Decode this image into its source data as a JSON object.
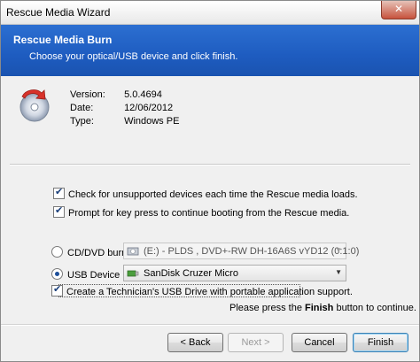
{
  "window": {
    "title": "Rescue Media Wizard",
    "close_glyph": "✕"
  },
  "banner": {
    "title": "Rescue Media Burn",
    "subtitle": "Choose your optical/USB device and click finish."
  },
  "info": {
    "icon": "disc-burn-icon",
    "rows": [
      {
        "label": "Version:",
        "value": "5.0.4694"
      },
      {
        "label": "Date:",
        "value": "12/06/2012"
      },
      {
        "label": "Type:",
        "value": "Windows PE"
      }
    ]
  },
  "options": {
    "check_unsupported": {
      "label": "Check for unsupported devices each time the Rescue media loads.",
      "checked": true
    },
    "prompt_keypress": {
      "label": "Prompt for key press to continue booting from the Rescue media.",
      "checked": true
    }
  },
  "devices": {
    "cd": {
      "label": "CD/DVD burner",
      "selected": false,
      "combo_value": "(E:) - PLDS    , DVD+-RW DH-16A6S vYD12 (0:1:0)",
      "icon": "optical-drive-icon"
    },
    "usb": {
      "label": "USB Device",
      "selected": true,
      "combo_value": "SanDisk Cruzer Micro",
      "icon": "usb-drive-icon"
    }
  },
  "technician": {
    "label": "Create a Technician's USB Drive with portable application support.",
    "checked": true
  },
  "hint": {
    "pre": "Please press the ",
    "bold": "Finish",
    "post": " button to continue."
  },
  "buttons": {
    "back": "< Back",
    "next": "Next >",
    "cancel": "Cancel",
    "finish": "Finish"
  },
  "colors": {
    "banner": "#1e5cc0",
    "accent": "#2c6fd1"
  }
}
